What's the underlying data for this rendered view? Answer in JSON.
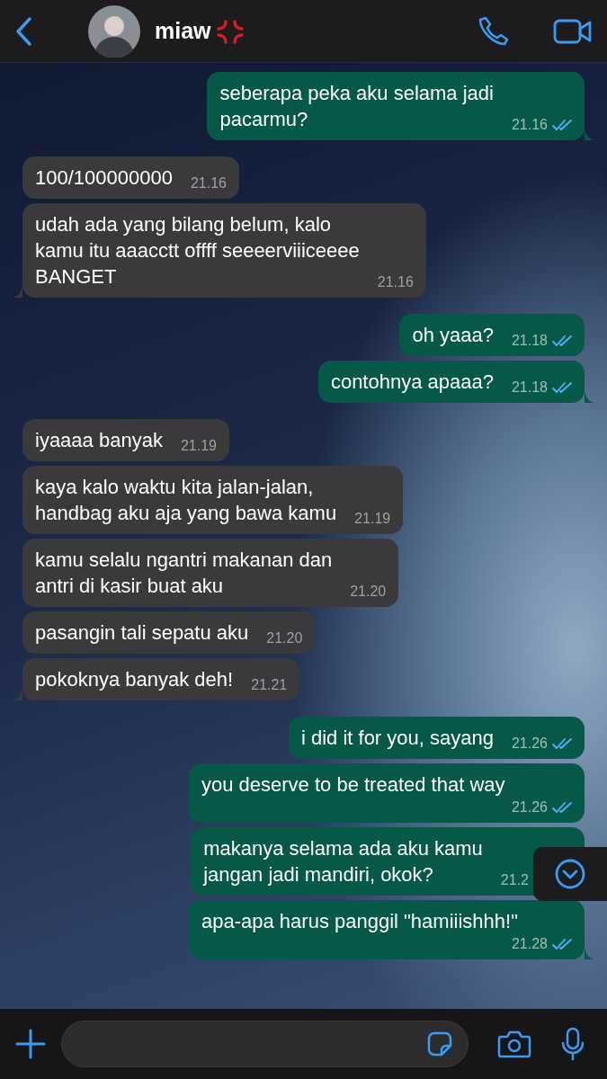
{
  "header": {
    "contact_name": "miaw"
  },
  "messages": [
    {
      "kind": "sent",
      "text": "seberapa peka aku selama jadi\npacarmu?",
      "time": "21.16",
      "read": true
    },
    {
      "kind": "received",
      "text": "100/100000000",
      "time": "21.16"
    },
    {
      "kind": "received",
      "text": "udah ada yang bilang belum, kalo\nkamu itu aaacctt offff seeeerviiiceeee\nBANGET",
      "time": "21.16"
    },
    {
      "kind": "sent",
      "text": "oh yaaa?",
      "time": "21.18",
      "read": true
    },
    {
      "kind": "sent",
      "text": "contohnya apaaa?",
      "time": "21.18",
      "read": true
    },
    {
      "kind": "received",
      "text": "iyaaaa banyak",
      "time": "21.19"
    },
    {
      "kind": "received",
      "text": "kaya kalo waktu kita jalan-jalan,\nhandbag aku aja yang bawa kamu",
      "time": "21.19"
    },
    {
      "kind": "received",
      "text": "kamu selalu ngantri makanan dan\nantri di kasir buat aku",
      "time": "21.20"
    },
    {
      "kind": "received",
      "text": "pasangin tali sepatu aku",
      "time": "21.20"
    },
    {
      "kind": "received",
      "text": "pokoknya banyak deh!",
      "time": "21.21"
    },
    {
      "kind": "sent",
      "text": "i did it for you, sayang",
      "time": "21.26",
      "read": true
    },
    {
      "kind": "sent",
      "text": "you deserve to be treated that way",
      "time": "21.26",
      "read": true
    },
    {
      "kind": "sent",
      "text": "makanya selama ada aku kamu\njangan jadi mandiri, okok?",
      "time": "21.2"
    },
    {
      "kind": "sent",
      "text": "apa-apa harus panggil \"hamiiishhh!\"",
      "time": "21.28",
      "read": true
    }
  ]
}
